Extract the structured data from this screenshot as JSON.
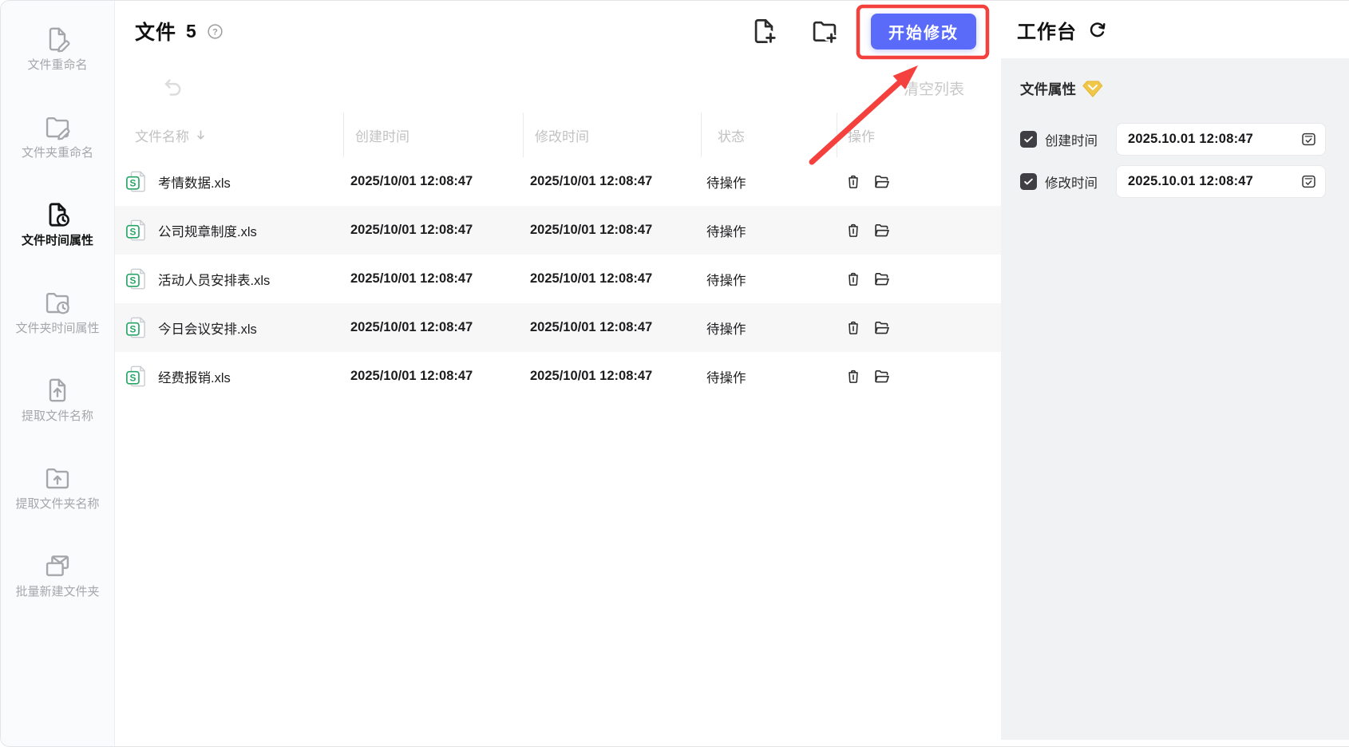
{
  "sidebar": {
    "items": [
      {
        "label": "文件重命名",
        "icon": "file-rename-icon",
        "active": false
      },
      {
        "label": "文件夹重命名",
        "icon": "folder-rename-icon",
        "active": false
      },
      {
        "label": "文件时间属性",
        "icon": "file-time-icon",
        "active": true
      },
      {
        "label": "文件夹时间属性",
        "icon": "folder-time-icon",
        "active": false
      },
      {
        "label": "提取文件名称",
        "icon": "extract-file-name-icon",
        "active": false
      },
      {
        "label": "提取文件夹名称",
        "icon": "extract-folder-name-icon",
        "active": false
      },
      {
        "label": "批量新建文件夹",
        "icon": "batch-new-folder-icon",
        "active": false
      }
    ]
  },
  "header": {
    "title": "文件",
    "count": "5",
    "start_button_label": "开始修改",
    "clear_list_label": "清空列表"
  },
  "table": {
    "headers": [
      "文件名称",
      "创建时间",
      "修改时间",
      "状态",
      "操作"
    ],
    "file_type_badge": "S",
    "rows": [
      {
        "name": "考情数据.xls",
        "created": "2025/10/01 12:08:47",
        "modified": "2025/10/01 12:08:47",
        "status": "待操作"
      },
      {
        "name": "公司规章制度.xls",
        "created": "2025/10/01 12:08:47",
        "modified": "2025/10/01 12:08:47",
        "status": "待操作"
      },
      {
        "name": "活动人员安排表.xls",
        "created": "2025/10/01 12:08:47",
        "modified": "2025/10/01 12:08:47",
        "status": "待操作"
      },
      {
        "name": "今日会议安排.xls",
        "created": "2025/10/01 12:08:47",
        "modified": "2025/10/01 12:08:47",
        "status": "待操作"
      },
      {
        "name": "经费报销.xls",
        "created": "2025/10/01 12:08:47",
        "modified": "2025/10/01 12:08:47",
        "status": "待操作"
      }
    ]
  },
  "workbench": {
    "title": "工作台",
    "section_title": "文件属性",
    "fields": [
      {
        "label": "创建时间",
        "value": "2025.10.01 12:08:47",
        "checked": true
      },
      {
        "label": "修改时间",
        "value": "2025.10.01 12:08:47",
        "checked": true
      }
    ]
  },
  "colors": {
    "accent_blue": "#5b6bf9",
    "annotation_red": "#f5413d",
    "excel_green": "#27a567",
    "vip_yellow": "#f1c74a"
  }
}
